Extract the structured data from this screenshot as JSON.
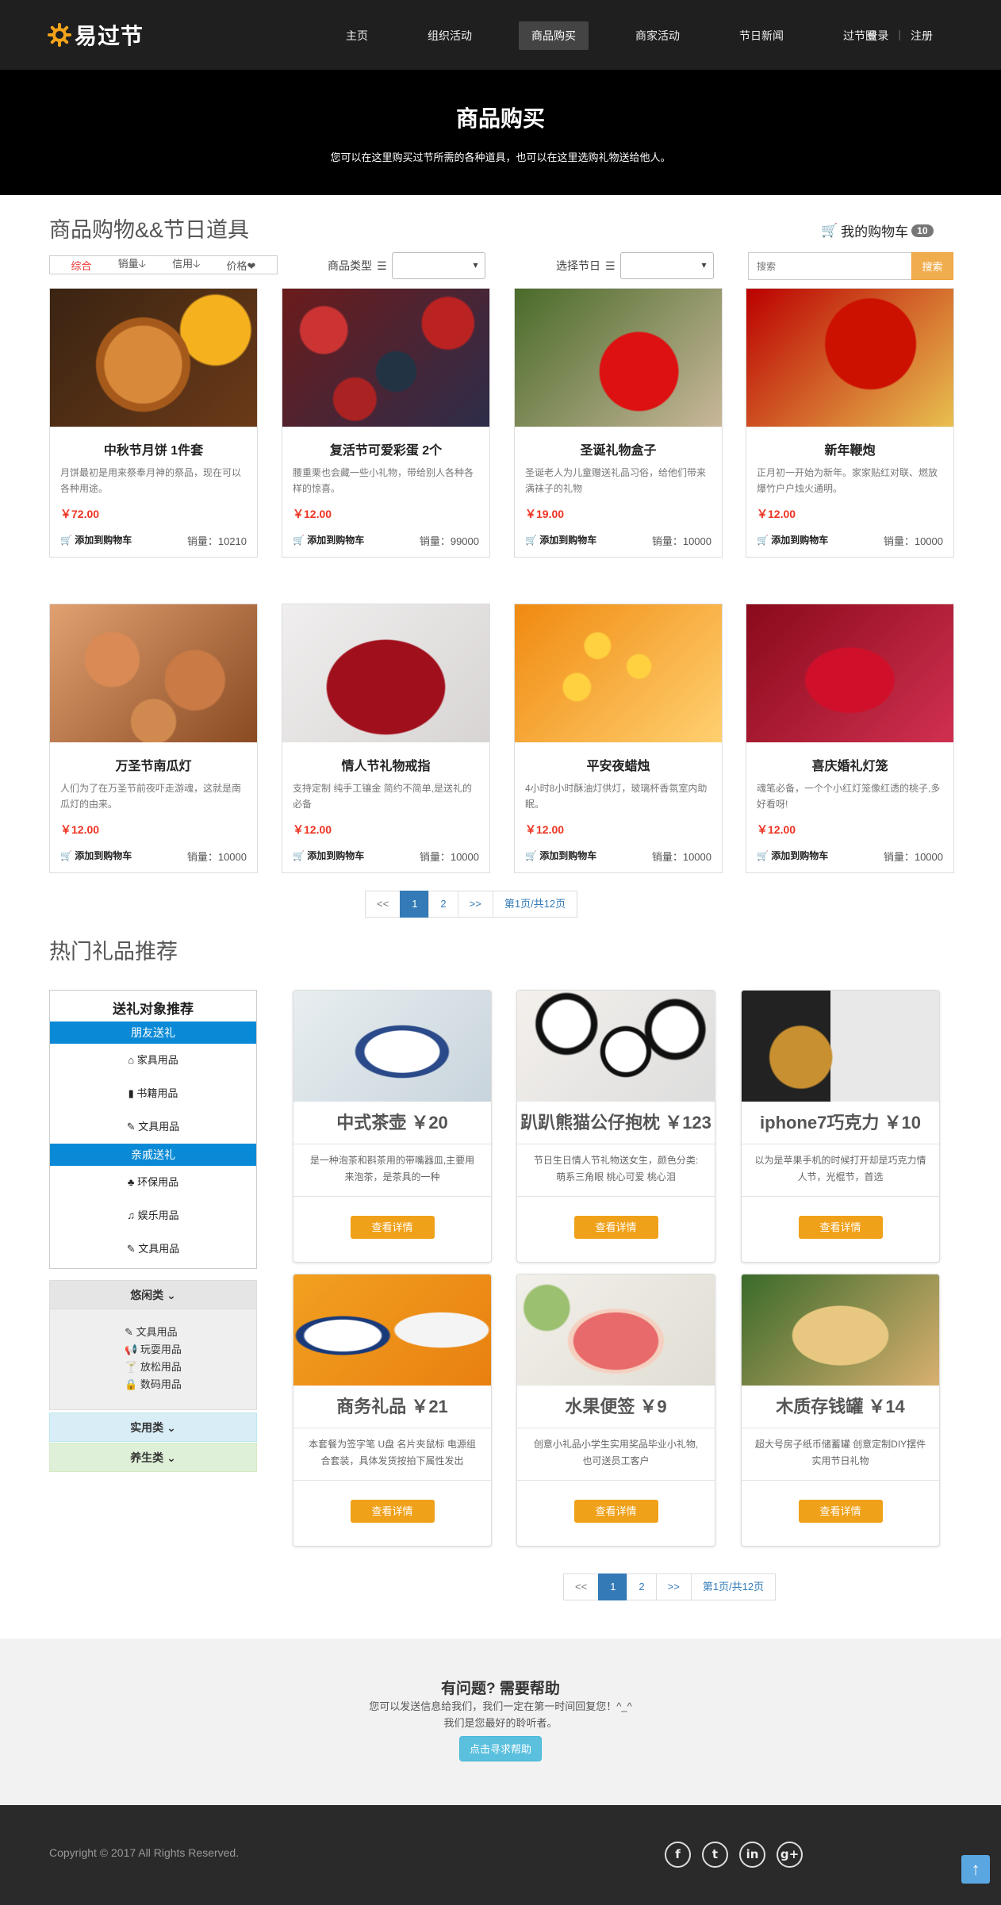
{
  "header": {
    "logo_text": "易过节",
    "nav": [
      "主页",
      "组织活动",
      "商品购买",
      "商家活动",
      "节日新闻",
      "过节圈"
    ],
    "active_nav": "商品购买",
    "login": "登录",
    "register": "注册"
  },
  "banner": {
    "title": "商品购买",
    "subtitle": "您可以在这里购买过节所需的各种道具，也可以在这里选购礼物送给他人。"
  },
  "shop": {
    "title": "商品购物&&节日道具",
    "cart_label": "我的购物车",
    "cart_count": "10",
    "sort": [
      "综合",
      "销量",
      "信用",
      "价格"
    ],
    "type_label": "商品类型",
    "festival_label": "选择节日",
    "search_placeholder": "搜索",
    "search_button": "搜索",
    "add_label": "添加到购物车",
    "products": [
      {
        "name": "中秋节月饼 1件套",
        "desc": "月饼最初是用来祭奉月神的祭品，现在可以各种用途。",
        "price": "￥72.00",
        "sales": "销量：10210"
      },
      {
        "name": "复活节可爱彩蛋 2个",
        "desc": "腰重栗也会藏一些小礼物，带给别人各种各样的惊喜。",
        "price": "￥12.00",
        "sales": "销量：99000"
      },
      {
        "name": "圣诞礼物盒子",
        "desc": "圣诞老人为儿童赠送礼品习俗，给他们带来满袜子的礼物",
        "price": "￥19.00",
        "sales": "销量：10000"
      },
      {
        "name": "新年鞭炮",
        "desc": "正月初一开始为新年。家家贴红对联、燃放爆竹户户烛火通明。",
        "price": "￥12.00",
        "sales": "销量：10000"
      },
      {
        "name": "万圣节南瓜灯",
        "desc": "人们为了在万圣节前夜吓走游魂，这就是南瓜灯的由来。",
        "price": "￥12.00",
        "sales": "销量：10000"
      },
      {
        "name": "情人节礼物戒指",
        "desc": "支持定制 纯手工镶金 简约不简单,是送礼的必备",
        "price": "￥12.00",
        "sales": "销量：10000"
      },
      {
        "name": "平安夜蜡烛",
        "desc": "4小时8小时酥油灯供灯，玻璃杯香氛室内助眠。",
        "price": "￥12.00",
        "sales": "销量：10000"
      },
      {
        "name": "喜庆婚礼灯笼",
        "desc": "魂笔必备，一个个小红灯笼像红透的桃子,多好看呀!",
        "price": "￥12.00",
        "sales": "销量：10000"
      }
    ]
  },
  "pager": {
    "prev": "<<",
    "p1": "1",
    "p2": "2",
    "next": ">>",
    "info": "第1页/共12页"
  },
  "gifts": {
    "title": "热门礼品推荐",
    "rec_title": "送礼对象推荐",
    "group1": "朋友送礼",
    "group1_items": [
      "家具用品",
      "书籍用品",
      "文具用品"
    ],
    "group2": "亲戚送礼",
    "group2_items": [
      "环保用品",
      "娱乐用品",
      "文具用品"
    ],
    "acc1": "悠闲类",
    "acc1_items": [
      "文具用品",
      "玩耍用品",
      "放松用品",
      "数码用品"
    ],
    "acc2": "实用类",
    "acc3": "养生类",
    "detail_label": "查看详情",
    "cards": [
      {
        "title": "中式茶壶 ￥20",
        "desc": "是一种泡茶和斟茶用的带嘴器皿,主要用来泡茶，是茶具的一种"
      },
      {
        "title": "趴趴熊猫公仔抱枕 ￥123",
        "desc": "节日生日情人节礼物送女生，颜色分类: 萌系三角眼 桃心可爱 桃心泪"
      },
      {
        "title": "iphone7巧克力 ￥10",
        "desc": "以为是苹果手机的时候打开却是巧克力情人节，光棍节，首选"
      },
      {
        "title": "商务礼品 ￥21",
        "desc": "本套餐为签字笔 U盘 名片夹鼠标 电源组合套装，具体发货按拍下属性发出"
      },
      {
        "title": "水果便签 ￥9",
        "desc": "创意小礼品小学生实用奖品毕业小礼物,也可送员工客户"
      },
      {
        "title": "木质存钱罐 ￥14",
        "desc": "超大号房子纸币储蓄罐 创意定制DIY摆件 实用节日礼物"
      }
    ]
  },
  "help": {
    "title": "有问题? 需要帮助",
    "line1": "您可以发送信息给我们，我们一定在第一时间回复您！^_^",
    "line2": "我们是您最好的聆听者。",
    "button": "点击寻求帮助"
  },
  "footer": {
    "copyright": "Copyright © 2017 All Rights Reserved."
  },
  "icons": {
    "social": [
      "facebook-icon",
      "twitter-icon",
      "linkedin-icon",
      "google-plus-icon"
    ]
  }
}
